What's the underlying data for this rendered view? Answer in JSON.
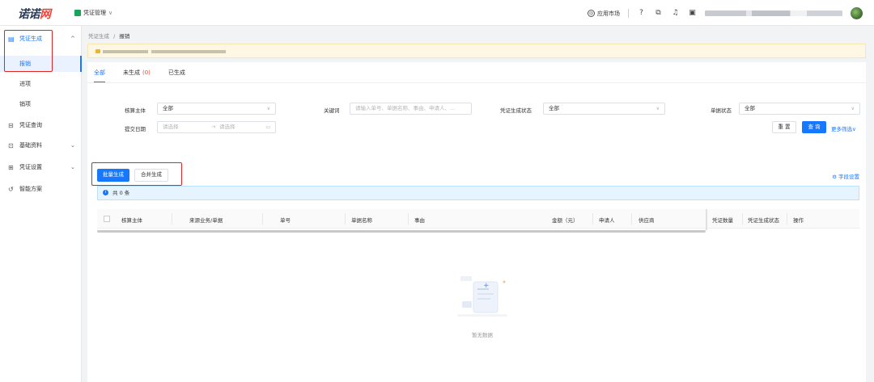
{
  "header": {
    "logo_main": "诺诺",
    "logo_accent": "网",
    "module_label": "凭证管理",
    "app_market_label": "应用市场"
  },
  "sidebar": {
    "items": [
      {
        "label": "凭证生成",
        "icon": "voucher-icon",
        "expanded": true
      },
      {
        "label": "报销",
        "active": true
      },
      {
        "label": "进项"
      },
      {
        "label": "销项"
      },
      {
        "label": "凭证查询",
        "icon": "search-doc-icon"
      },
      {
        "label": "基础资料",
        "icon": "data-icon"
      },
      {
        "label": "凭证设置",
        "icon": "settings-doc-icon"
      },
      {
        "label": "智能方案",
        "icon": "smart-icon"
      }
    ]
  },
  "breadcrumb": {
    "parent": "凭证生成",
    "sep": "/",
    "current": "报销"
  },
  "tabs": [
    {
      "label": "全部",
      "active": true
    },
    {
      "label": "未生成",
      "count": "(0)"
    },
    {
      "label": "已生成"
    }
  ],
  "filters": {
    "entity_label": "核算主体",
    "entity_value": "全部",
    "keyword_label": "关键词",
    "keyword_placeholder": "请输入单号、单据名称、事由、申请人、...",
    "status_label": "凭证生成状态",
    "status_value": "全部",
    "doc_status_label": "单据状态",
    "doc_status_value": "全部",
    "date_label": "提交日期",
    "date_start_placeholder": "请选择",
    "date_sep": "→",
    "date_end_placeholder": "请选择",
    "reset_label": "重 置",
    "query_label": "查 询",
    "more_label": "更多筛选∨"
  },
  "actions": {
    "batch_label": "批量生成",
    "merge_label": "合并生成",
    "column_settings_label": "字段设置"
  },
  "info_bar": {
    "text": "共 0 条"
  },
  "table": {
    "columns": [
      "核算主体",
      "来源业务/单据",
      "单号",
      "单据名称",
      "事由",
      "金额（元）",
      "申请人",
      "供应商",
      "凭证数量",
      "凭证生成状态",
      "操作"
    ]
  },
  "empty": {
    "text": "暂无数据"
  },
  "colors": {
    "primary": "#1677ff",
    "highlight": "#e02424",
    "notice_bg": "#fdf7e3"
  }
}
